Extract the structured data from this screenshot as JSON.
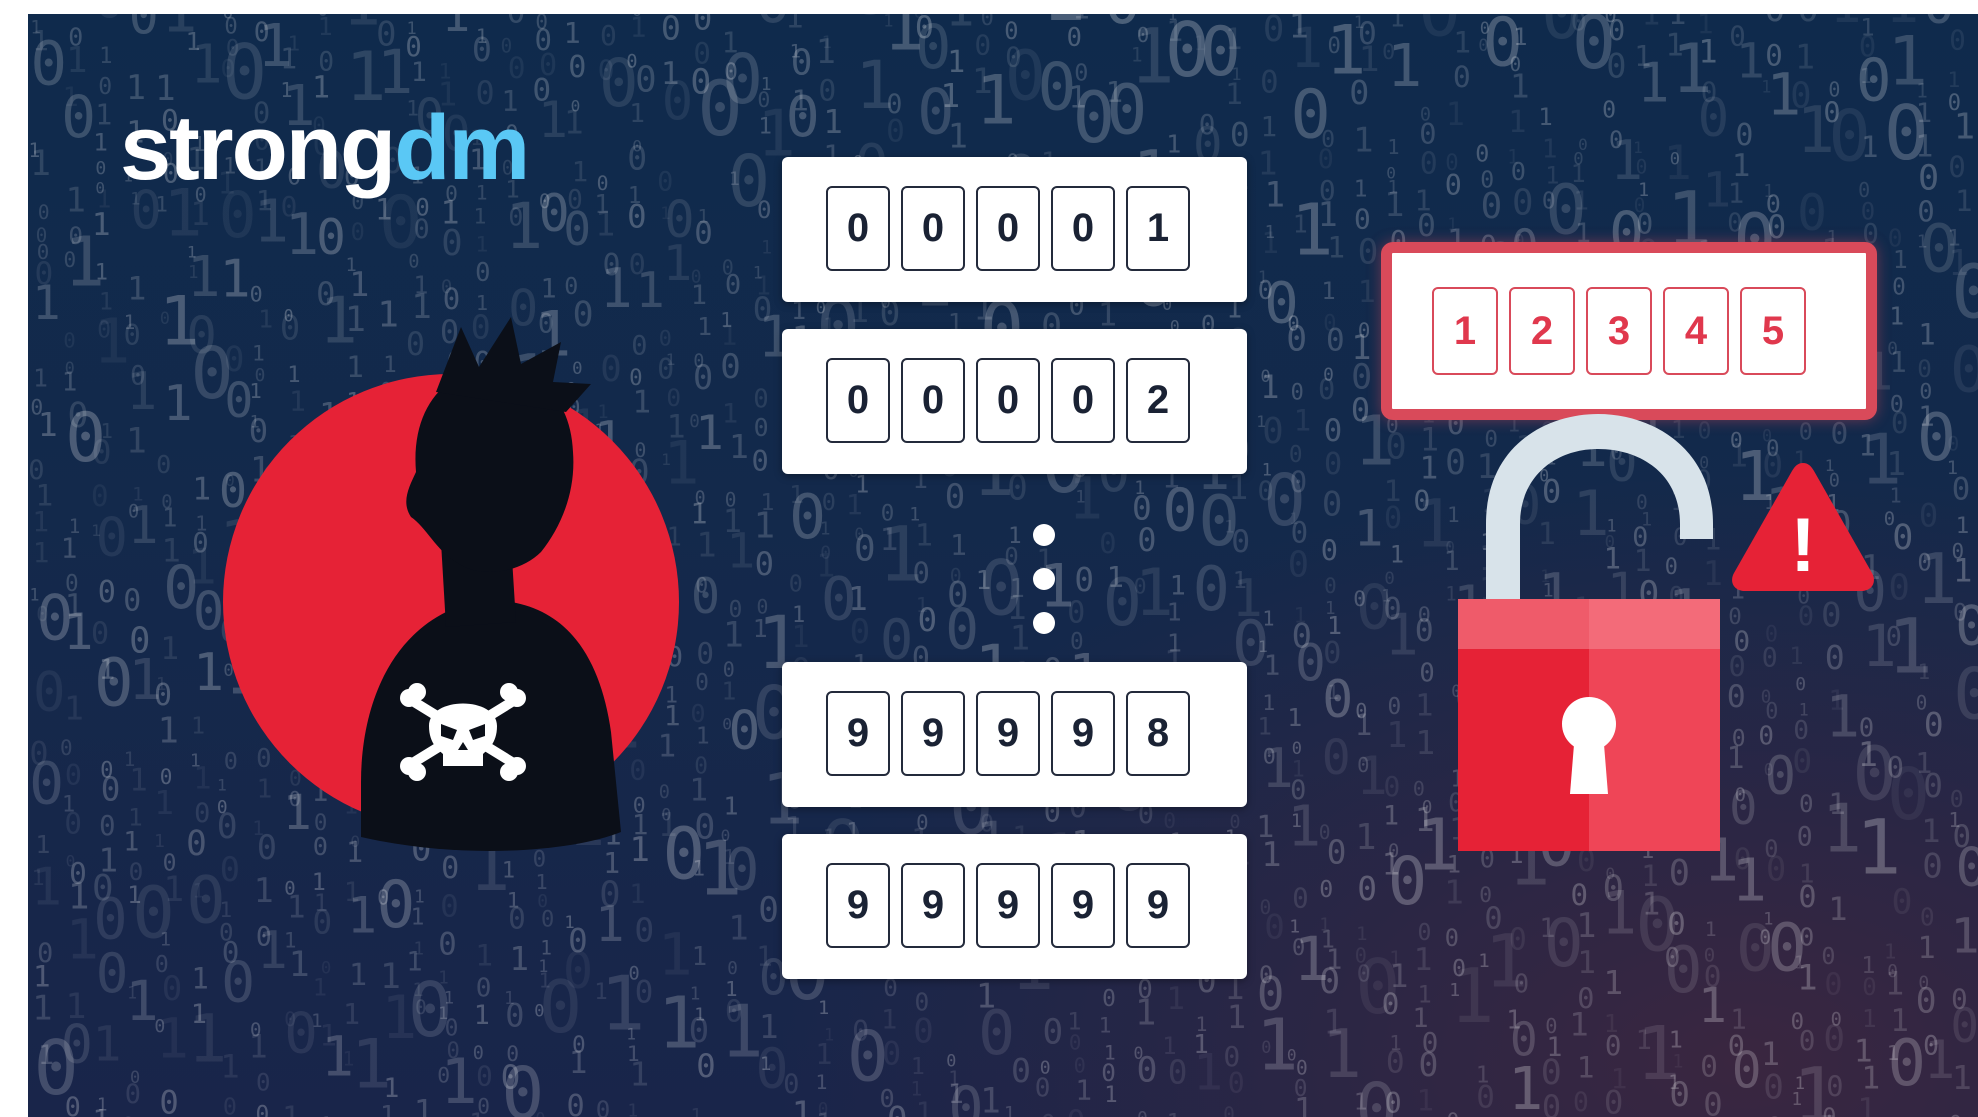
{
  "brand": {
    "logo_main": "strong",
    "logo_accent": "dm",
    "accent_color": "#5ac8f5"
  },
  "attempts": [
    {
      "digits": [
        "0",
        "0",
        "0",
        "0",
        "1"
      ]
    },
    {
      "digits": [
        "0",
        "0",
        "0",
        "0",
        "2"
      ]
    },
    {
      "digits": [
        "9",
        "9",
        "9",
        "9",
        "8"
      ]
    },
    {
      "digits": [
        "9",
        "9",
        "9",
        "9",
        "9"
      ]
    }
  ],
  "target_pin": {
    "digits": [
      "1",
      "2",
      "3",
      "4",
      "5"
    ],
    "color": "#d94a5a"
  },
  "warning": {
    "symbol": "!",
    "color": "#e62236"
  },
  "colors": {
    "background": "#13294b",
    "danger_red": "#e62236",
    "silhouette": "#0b0f18",
    "shackle": "#d8e3ea"
  },
  "icons": [
    "attacker-silhouette-icon",
    "skull-crossbones-icon",
    "ellipsis-icon",
    "open-padlock-icon",
    "keyhole-icon",
    "warning-triangle-icon"
  ]
}
